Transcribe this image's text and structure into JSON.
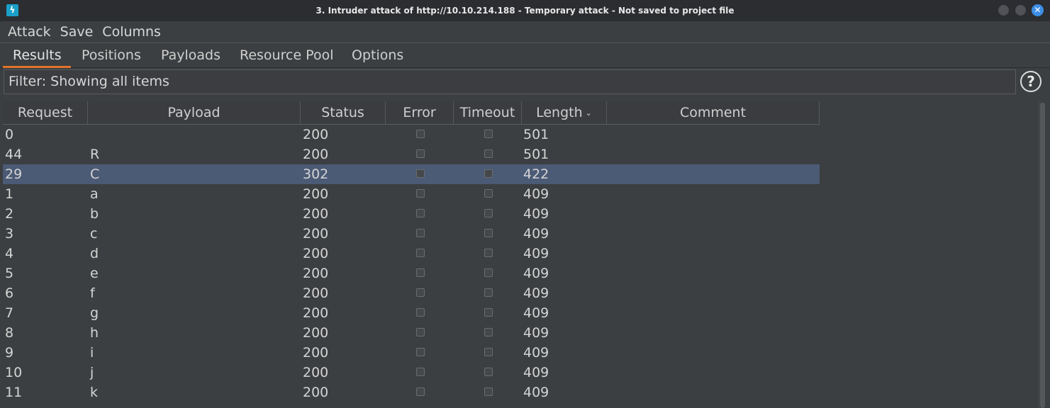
{
  "window": {
    "title": "3. Intruder attack of http://10.10.214.188 - Temporary attack - Not saved to project file",
    "app_icon": "burp-lightning-icon"
  },
  "menu": [
    "Attack",
    "Save",
    "Columns"
  ],
  "tabs": {
    "items": [
      "Results",
      "Positions",
      "Payloads",
      "Resource Pool",
      "Options"
    ],
    "active": "Results"
  },
  "filter": {
    "text": "Filter: Showing all items",
    "help_icon": "question-icon"
  },
  "table": {
    "columns": [
      "Request",
      "Payload",
      "Status",
      "Error",
      "Timeout",
      "Length",
      "Comment"
    ],
    "sorted_column": "Length",
    "sort_direction": "descending",
    "selected_request": "29",
    "rows": [
      {
        "request": "0",
        "payload": "",
        "status": "200",
        "error": false,
        "timeout": false,
        "length": "501"
      },
      {
        "request": "44",
        "payload": "R",
        "status": "200",
        "error": false,
        "timeout": false,
        "length": "501"
      },
      {
        "request": "29",
        "payload": "C",
        "status": "302",
        "error": false,
        "timeout": false,
        "length": "422"
      },
      {
        "request": "1",
        "payload": "a",
        "status": "200",
        "error": false,
        "timeout": false,
        "length": "409"
      },
      {
        "request": "2",
        "payload": "b",
        "status": "200",
        "error": false,
        "timeout": false,
        "length": "409"
      },
      {
        "request": "3",
        "payload": "c",
        "status": "200",
        "error": false,
        "timeout": false,
        "length": "409"
      },
      {
        "request": "4",
        "payload": "d",
        "status": "200",
        "error": false,
        "timeout": false,
        "length": "409"
      },
      {
        "request": "5",
        "payload": "e",
        "status": "200",
        "error": false,
        "timeout": false,
        "length": "409"
      },
      {
        "request": "6",
        "payload": "f",
        "status": "200",
        "error": false,
        "timeout": false,
        "length": "409"
      },
      {
        "request": "7",
        "payload": "g",
        "status": "200",
        "error": false,
        "timeout": false,
        "length": "409"
      },
      {
        "request": "8",
        "payload": "h",
        "status": "200",
        "error": false,
        "timeout": false,
        "length": "409"
      },
      {
        "request": "9",
        "payload": "i",
        "status": "200",
        "error": false,
        "timeout": false,
        "length": "409"
      },
      {
        "request": "10",
        "payload": "j",
        "status": "200",
        "error": false,
        "timeout": false,
        "length": "409"
      },
      {
        "request": "11",
        "payload": "k",
        "status": "200",
        "error": false,
        "timeout": false,
        "length": "409"
      }
    ]
  },
  "colors": {
    "selection": "#4b5a75",
    "tab_accent": "#e2722b",
    "close_button": "#3d8ee6"
  }
}
